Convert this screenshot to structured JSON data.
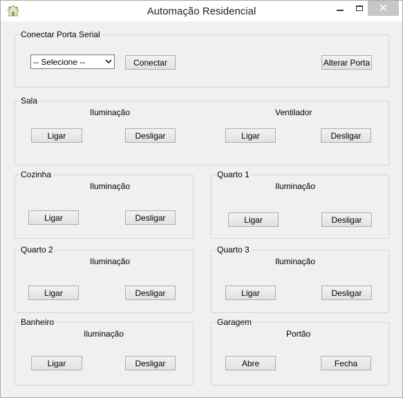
{
  "window": {
    "title": "Automação Residencial",
    "close_glyph": "✕"
  },
  "serial": {
    "legend": "Conectar Porta Serial",
    "select_value": "-- Selecione --",
    "connect_label": "Conectar",
    "change_port_label": "Alterar Porta"
  },
  "sala": {
    "legend": "Sala",
    "lighting_label": "Iluminação",
    "fan_label": "Ventilador",
    "on_label": "Ligar",
    "off_label": "Desligar"
  },
  "cozinha": {
    "legend": "Cozinha",
    "lighting_label": "Iluminação",
    "on_label": "Ligar",
    "off_label": "Desligar"
  },
  "quarto1": {
    "legend": "Quarto 1",
    "lighting_label": "Iluminação",
    "on_label": "Ligar",
    "off_label": "Desligar"
  },
  "quarto2": {
    "legend": "Quarto 2",
    "lighting_label": "Iluminação",
    "on_label": "Ligar",
    "off_label": "Desligar"
  },
  "quarto3": {
    "legend": "Quarto 3",
    "lighting_label": "Iluminação",
    "on_label": "Ligar",
    "off_label": "Desligar"
  },
  "banheiro": {
    "legend": "Banheiro",
    "lighting_label": "Iluminação",
    "on_label": "Ligar",
    "off_label": "Desligar"
  },
  "garagem": {
    "legend": "Garagem",
    "gate_label": "Portão",
    "open_label": "Abre",
    "close_label": "Fecha"
  }
}
